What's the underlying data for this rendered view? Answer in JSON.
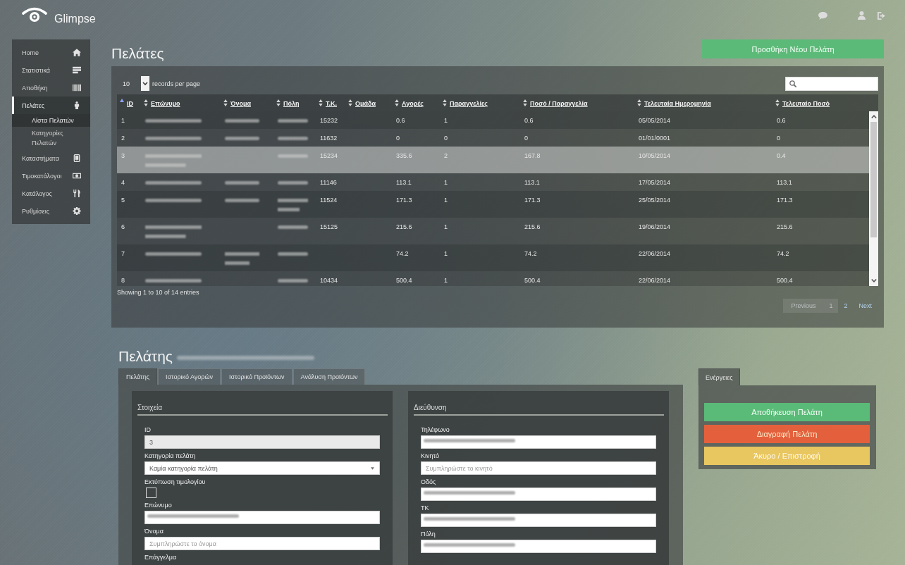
{
  "app": {
    "name": "Glimpse"
  },
  "sidebar": {
    "items": [
      {
        "label": "Home",
        "selected": false
      },
      {
        "label": "Στατιστικά",
        "selected": false
      },
      {
        "label": "Αποθήκη",
        "selected": false
      },
      {
        "label": "Πελάτες",
        "selected": true,
        "children": [
          {
            "label": "Λίστα Πελατών",
            "selected": true
          },
          {
            "label": "Κατηγορίες Πελατών",
            "selected": false
          }
        ]
      },
      {
        "label": "Καταστήματα",
        "selected": false
      },
      {
        "label": "Τιμοκατάλογοι",
        "selected": false
      },
      {
        "label": "Κατάλογος",
        "selected": false
      },
      {
        "label": "Ρυθμίσεις",
        "selected": false
      }
    ]
  },
  "page": {
    "title": "Πελάτες",
    "add_button": "Προσθήκη Νέου Πελάτη"
  },
  "table": {
    "length": {
      "value": "10",
      "label": "records per page"
    },
    "columns": [
      {
        "label": "ID",
        "sorted": true
      },
      {
        "label": "Επώνυμο",
        "sorted": false
      },
      {
        "label": "Όνομα",
        "sorted": false
      },
      {
        "label": "Πόλη",
        "sorted": false
      },
      {
        "label": "Τ.Κ.",
        "sorted": false
      },
      {
        "label": "Ομάδα",
        "sorted": false
      },
      {
        "label": "Αγορές",
        "sorted": false
      },
      {
        "label": "Παραγγελίες",
        "sorted": false
      },
      {
        "label": "Ποσό / Παραγγελία",
        "sorted": false
      },
      {
        "label": "Τελευταία Ημερομηνία",
        "sorted": false
      },
      {
        "label": "Τελευταίο Ποσό",
        "sorted": false
      }
    ],
    "rows": [
      {
        "selected": false,
        "id": "1",
        "surname": {
          "kind": "blurred",
          "wrapped": false
        },
        "name": {
          "kind": "blurred",
          "wrapped": false
        },
        "city": {
          "kind": "blurred",
          "wrapped": false
        },
        "postcode": "15232",
        "purchases": "0.6",
        "orders": "1",
        "amount_per_order": "0.6",
        "last_date": "05/05/2014",
        "last_amount": "0.6"
      },
      {
        "selected": false,
        "id": "2",
        "surname": {
          "kind": "blurred",
          "wrapped": false
        },
        "name": {
          "kind": "blurred",
          "wrapped": false
        },
        "city": {
          "kind": "blurred",
          "wrapped": false
        },
        "postcode": "11632",
        "purchases": "0",
        "orders": "0",
        "amount_per_order": "0",
        "last_date": "01/01/0001",
        "last_amount": "0"
      },
      {
        "selected": true,
        "id": "3",
        "surname": {
          "kind": "blurred",
          "wrapped": true
        },
        "city": {
          "kind": "blurred",
          "wrapped": false
        },
        "postcode": "15234",
        "purchases": "335.6",
        "orders": "2",
        "amount_per_order": "167.8",
        "last_date": "10/05/2014",
        "last_amount": "0.4"
      },
      {
        "selected": false,
        "id": "4",
        "surname": {
          "kind": "blurred",
          "wrapped": false
        },
        "name": {
          "kind": "blurred",
          "wrapped": false
        },
        "city": {
          "kind": "blurred",
          "wrapped": false
        },
        "postcode": "11146",
        "purchases": "113.1",
        "orders": "1",
        "amount_per_order": "113.1",
        "last_date": "17/05/2014",
        "last_amount": "113.1"
      },
      {
        "selected": false,
        "id": "5",
        "surname": {
          "kind": "blurred",
          "wrapped": false
        },
        "name": {
          "kind": "blurred",
          "wrapped": false
        },
        "city": {
          "kind": "blurred",
          "wrapped": true
        },
        "postcode": "11524",
        "purchases": "171.3",
        "orders": "1",
        "amount_per_order": "171.3",
        "last_date": "25/05/2014",
        "last_amount": "171.3"
      },
      {
        "selected": false,
        "id": "6",
        "surname": {
          "kind": "blurred",
          "wrapped": true
        },
        "city": {
          "kind": "blurred",
          "wrapped": false
        },
        "postcode": "15125",
        "purchases": "215.6",
        "orders": "1",
        "amount_per_order": "215.6",
        "last_date": "19/06/2014",
        "last_amount": "215.6"
      },
      {
        "selected": false,
        "id": "7",
        "surname": {
          "kind": "blurred",
          "wrapped": false
        },
        "name": {
          "kind": "blurred",
          "wrapped": true
        },
        "city": {
          "kind": "blurred",
          "wrapped": false
        },
        "purchases": "74.2",
        "orders": "1",
        "amount_per_order": "74.2",
        "last_date": "22/06/2014",
        "last_amount": "74.2"
      },
      {
        "selected": false,
        "id": "8",
        "surname": {
          "kind": "blurred",
          "wrapped": false
        },
        "city": {
          "kind": "blurred",
          "wrapped": false
        },
        "postcode": "10434",
        "purchases": "500.4",
        "orders": "1",
        "amount_per_order": "500.4",
        "last_date": "22/06/2014",
        "last_amount": "500.4"
      }
    ],
    "info": "Showing 1 to 10 of 14 entries",
    "pagination": {
      "previous": {
        "label": "Previous",
        "disabled": true
      },
      "pages": [
        {
          "label": "1",
          "selected": true
        },
        {
          "label": "2",
          "selected": false
        }
      ],
      "next": {
        "label": "Next",
        "disabled": false
      }
    }
  },
  "customer": {
    "title": "Πελάτης",
    "name_blurred": true,
    "tabs": [
      {
        "label": "Πελάτης",
        "selected": true
      },
      {
        "label": "Ιστορικό Αγορών",
        "selected": false
      },
      {
        "label": "Ιστορικό Προϊόντων",
        "selected": false
      },
      {
        "label": "Ανάλυση Προϊόντων",
        "selected": false
      }
    ],
    "sections": [
      {
        "title": "Στοιχεία",
        "fields": [
          {
            "label": "ID",
            "kind": "text",
            "value": "3",
            "disabled": true,
            "blurred": false
          },
          {
            "label": "Κατηγορία πελάτη",
            "kind": "select",
            "value": "Καμία κατηγορία πελάτη"
          },
          {
            "label": "Εκτύπωση τιμολογίου",
            "kind": "checkbox",
            "checked": false
          },
          {
            "label": "Επώνυμο",
            "kind": "text",
            "disabled": false,
            "blurred": true
          },
          {
            "label": "Όνομα",
            "kind": "text",
            "placeholder": "Συμπληρώστε το όνομα",
            "disabled": false,
            "blurred": false
          },
          {
            "label": "Επάγγελμα",
            "kind": "label"
          }
        ]
      },
      {
        "title": "Διεύθυνση",
        "fields": [
          {
            "label": "Τηλέφωνο",
            "kind": "text",
            "disabled": false,
            "blurred": true
          },
          {
            "label": "Κινητό",
            "kind": "text",
            "placeholder": "Συμπληρώστε το κινητό",
            "disabled": false,
            "blurred": false
          },
          {
            "label": "Οδός",
            "kind": "text",
            "disabled": false,
            "blurred": true
          },
          {
            "label": "ΤΚ",
            "kind": "text",
            "disabled": false,
            "blurred": true
          },
          {
            "label": "Πόλη",
            "kind": "text",
            "disabled": false,
            "blurred": true
          }
        ]
      }
    ]
  },
  "actions": {
    "tabs": [
      {
        "label": "Ενέργειες",
        "selected": true
      }
    ],
    "buttons": [
      {
        "label": "Αποθήκευση Πελάτη",
        "kind": "save"
      },
      {
        "label": "Διαγραφή Πελάτη",
        "kind": "delete"
      },
      {
        "label": "Άκυρο / Επιστροφή",
        "kind": "cancel"
      }
    ]
  }
}
